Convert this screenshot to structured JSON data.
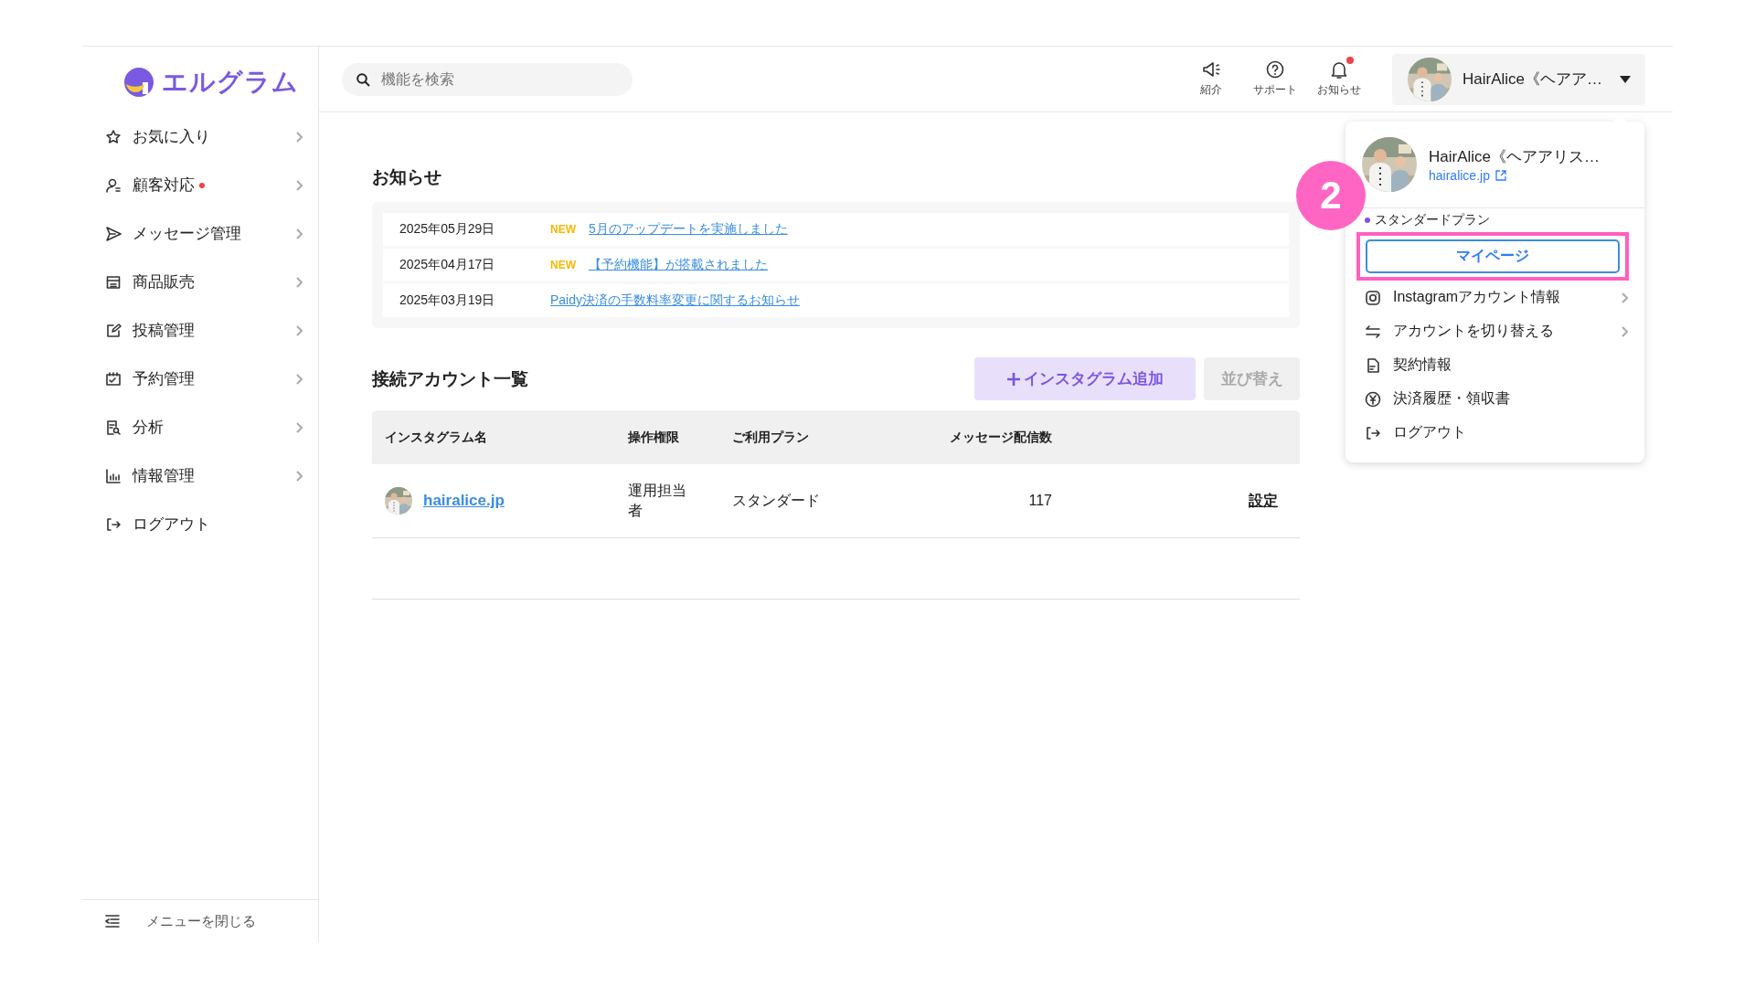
{
  "logo": {
    "text": "エルグラム"
  },
  "sidebar": {
    "items": [
      {
        "label": "お気に入り",
        "alert": false
      },
      {
        "label": "顧客対応",
        "alert": true
      },
      {
        "label": "メッセージ管理",
        "alert": false
      },
      {
        "label": "商品販売",
        "alert": false
      },
      {
        "label": "投稿管理",
        "alert": false
      },
      {
        "label": "予約管理",
        "alert": false
      },
      {
        "label": "分析",
        "alert": false
      },
      {
        "label": "情報管理",
        "alert": false
      }
    ],
    "logout": "ログアウト",
    "collapse": "メニューを閉じる"
  },
  "header": {
    "search": {
      "placeholder": "機能を検索"
    },
    "nav": [
      {
        "label": "紹介",
        "unread": false
      },
      {
        "label": "サポート",
        "unread": false
      },
      {
        "label": "お知らせ",
        "unread": true
      }
    ],
    "account": {
      "name": "HairAlice《ヘアア…",
      "expanded": true
    }
  },
  "notices": {
    "title": "お知らせ",
    "items": [
      {
        "date": "2025年05月29日",
        "badge": "NEW",
        "title": "5月のアップデートを実施しました"
      },
      {
        "date": "2025年04月17日",
        "badge": "NEW",
        "title": "【予約機能】が搭載されました"
      },
      {
        "date": "2025年03月19日",
        "title": "Paidy決済の手数料率変更に関するお知らせ"
      }
    ]
  },
  "accounts": {
    "title": "接続アカウント一覧",
    "add_button": "インスタグラム追加",
    "sort_button": {
      "label": "並び替え",
      "disabled": true
    },
    "columns": [
      "インスタグラム名",
      "操作権限",
      "ご利用プラン",
      "メッセージ配信数"
    ],
    "rows": [
      {
        "name": "hairalice.jp",
        "role": "運用担当者",
        "plan": "スタンダード",
        "messages": "117",
        "action": "設定"
      }
    ]
  },
  "menu": {
    "name": "HairAlice《ヘアアリス…",
    "link": "hairalice.jp",
    "plan": "スタンダードプラン",
    "mypage": "マイページ",
    "items": [
      {
        "label": "Instagramアカウント情報",
        "submenu": true
      },
      {
        "label": "アカウントを切り替える",
        "submenu": true
      },
      {
        "label": "契約情報",
        "submenu": false
      },
      {
        "label": "決済履歴・領収書",
        "submenu": false
      },
      {
        "label": "ログアウト",
        "submenu": false
      }
    ]
  },
  "annotation": {
    "number": "2"
  }
}
